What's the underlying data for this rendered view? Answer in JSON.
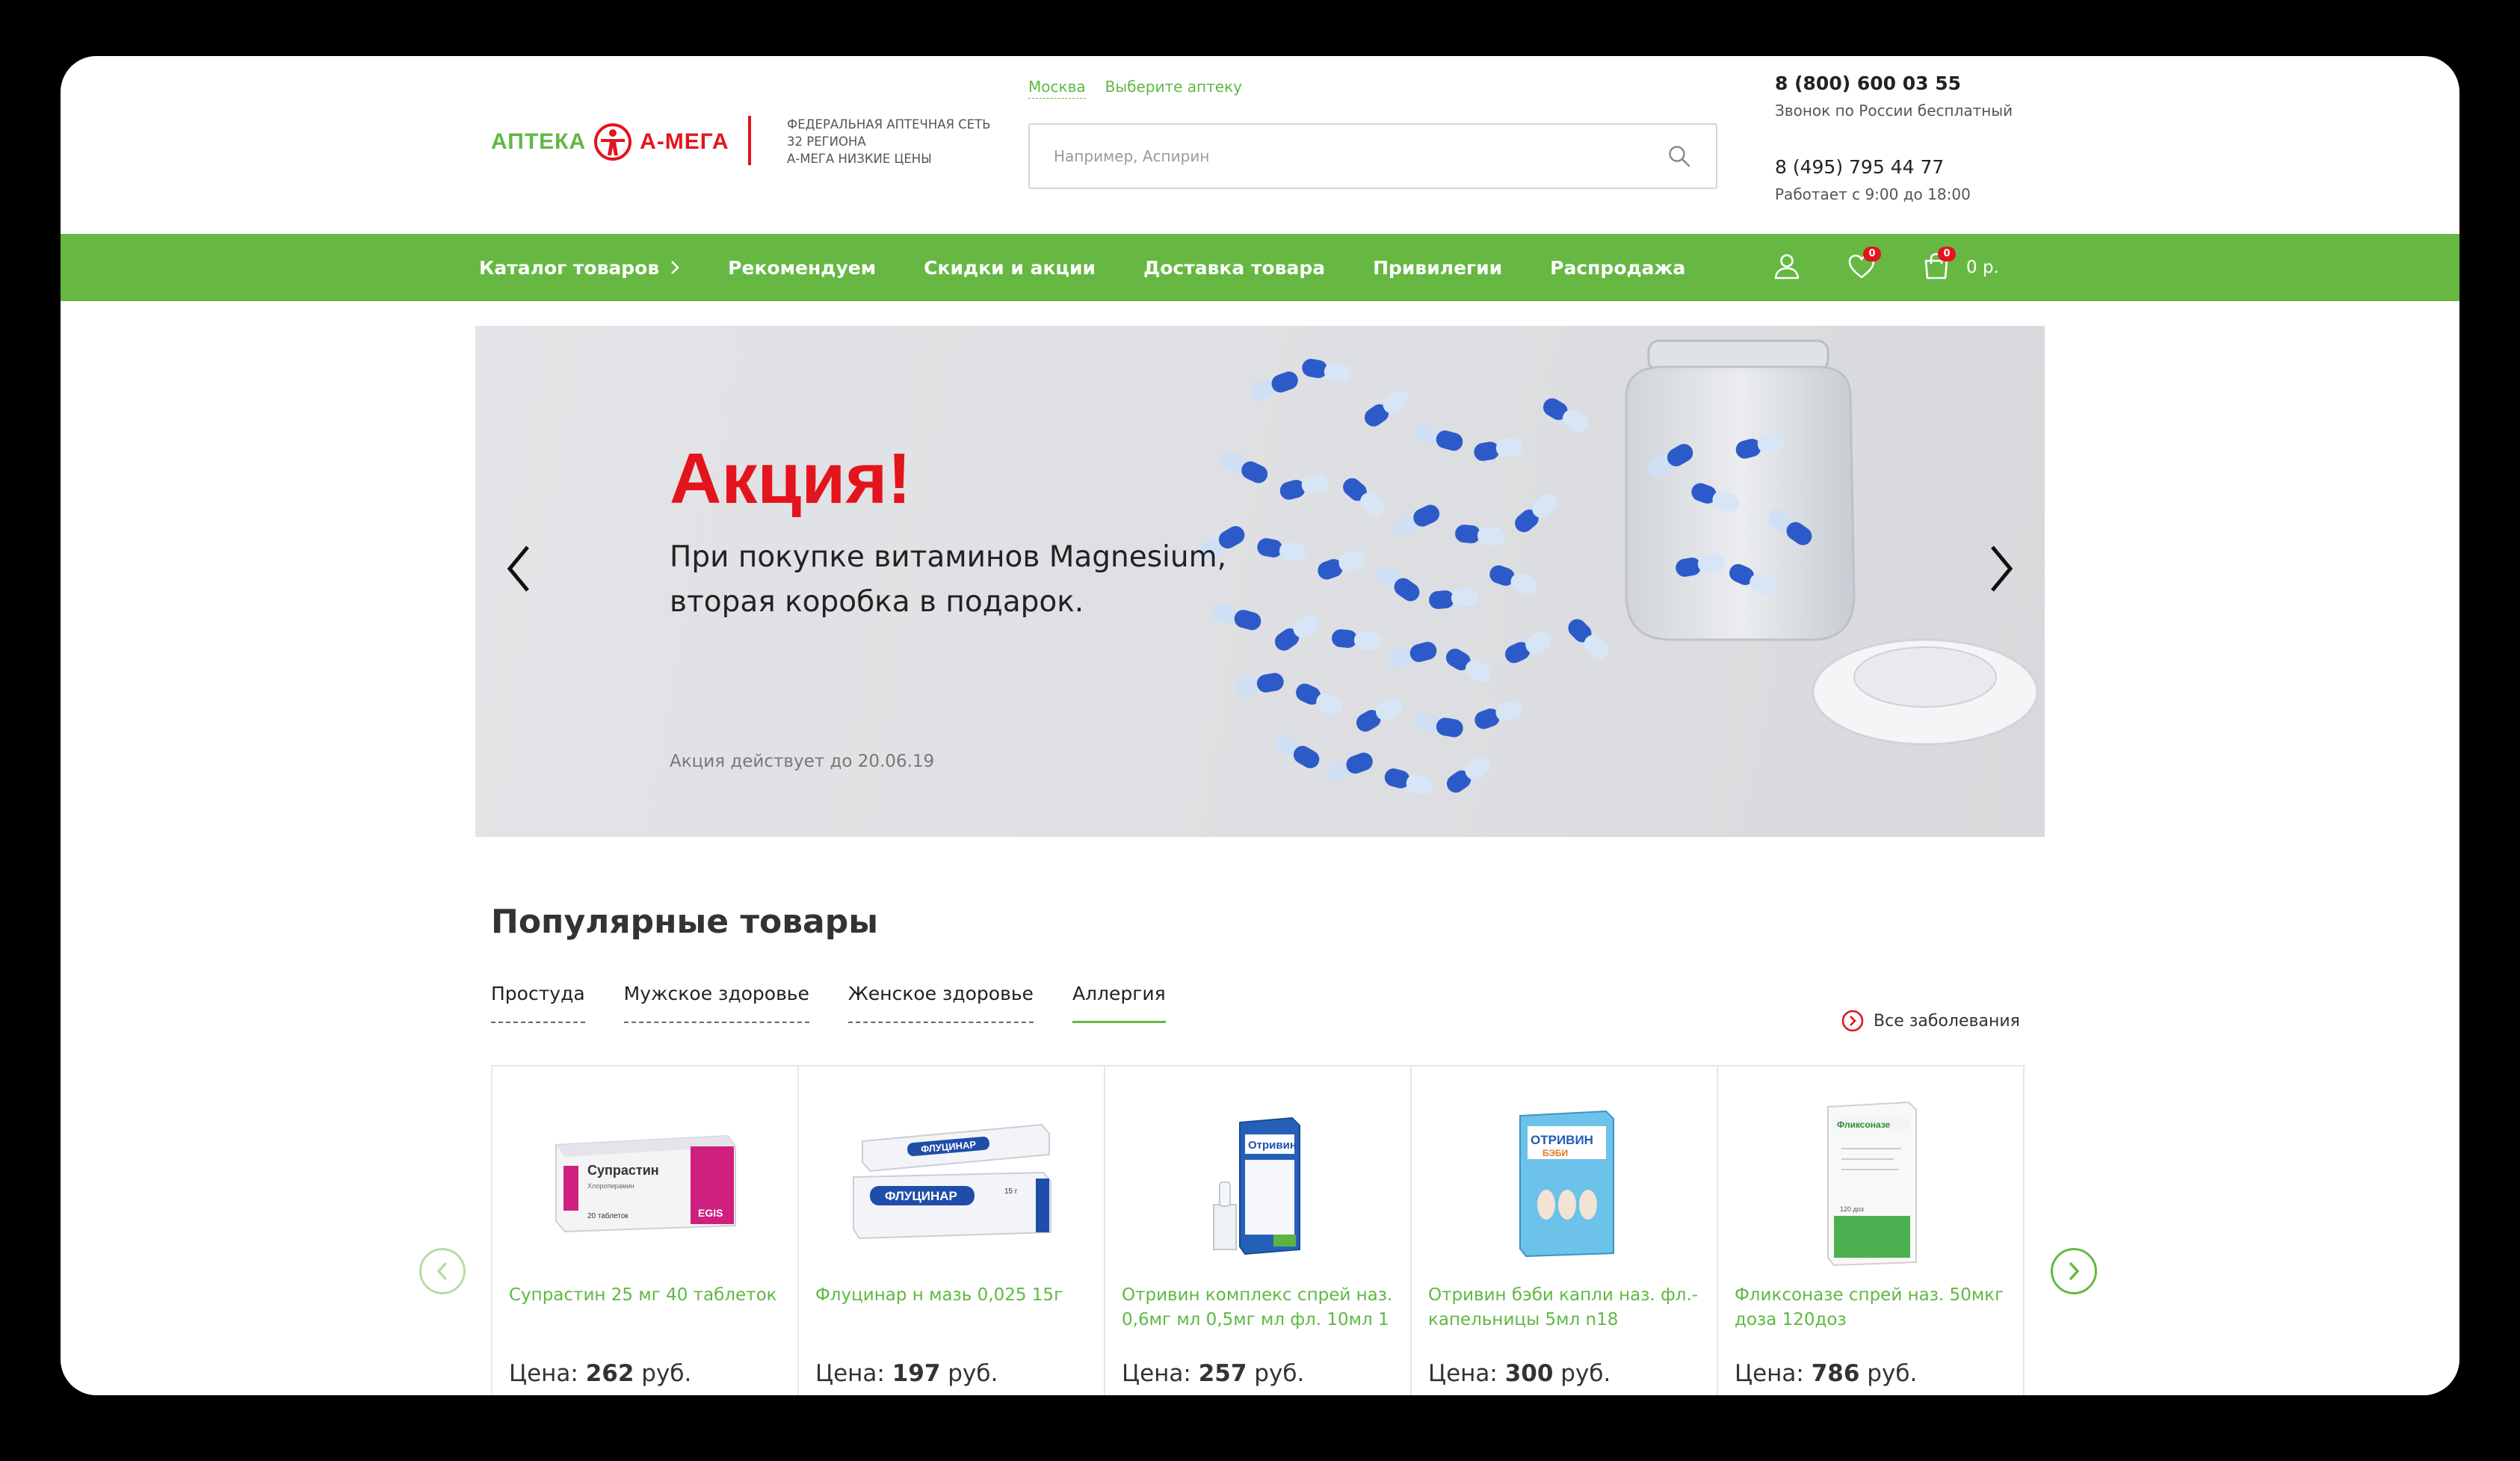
{
  "brand": {
    "name_left": "АПТЕКА",
    "name_right": "А-МЕГА",
    "tagline": [
      "ФЕДЕРАЛЬНАЯ АПТЕЧНАЯ СЕТЬ",
      "32 РЕГИОНА",
      "А-МЕГА НИЗКИЕ ЦЕНЫ"
    ],
    "colors": {
      "green": "#66b843",
      "red": "#e3141c"
    }
  },
  "location": {
    "city": "Москва",
    "choose_pharmacy": "Выберите аптеку"
  },
  "search": {
    "placeholder": "Например, Аспирин",
    "icon": "search-icon"
  },
  "contacts": {
    "phone1": "8 (800) 600 03 55",
    "phone1_note": "Звонок по России бесплатный",
    "phone2": "8 (495) 795 44 77",
    "phone2_note": "Работает с 9:00 до 18:00"
  },
  "nav": {
    "items": [
      "Каталог товаров",
      "Рекомендуем",
      "Скидки и акции",
      "Доставка товара",
      "Привилегии",
      "Распродажа"
    ],
    "favorites_count": "0",
    "cart_count": "0",
    "cart_sum": "0 р."
  },
  "banner": {
    "title": "Акция!",
    "text_line1": "При покупке витаминов Magnesium,",
    "text_line2": "вторая коробка в подарок.",
    "note": "Акция действует до 20.06.19"
  },
  "popular": {
    "title": "Популярные товары",
    "tabs": [
      "Простуда",
      "Мужское здоровье",
      "Женское здоровье",
      "Аллергия"
    ],
    "active_tab": "Аллергия",
    "all_link": "Все заболевания",
    "price_prefix": "Цена:",
    "price_suffix": "руб.",
    "products": [
      {
        "name": "Супрастин 25 мг 40 таблеток",
        "price": "262"
      },
      {
        "name": "Флуцинар н мазь 0,025 15г",
        "price": "197"
      },
      {
        "name": "Отривин комплекс спрей наз. 0,6мг мл 0,5мг мл фл. 10мл 1",
        "price": "257"
      },
      {
        "name": "Отривин бэби капли наз. фл.-капельницы 5мл n18",
        "price": "300"
      },
      {
        "name": "Фликсоназе спрей наз. 50мкг доза 120доз",
        "price": "786"
      }
    ],
    "package_labels": {
      "p1_brand": "Супрастин",
      "p1_sub": "Хлоропирамин",
      "p1_count": "20 таблеток",
      "p1_maker": "EGIS",
      "p2_brand": "ФЛУЦИНАР",
      "p2_weight": "15 г",
      "p3_brand": "Отривин",
      "p4_brand": "ОТРИВИН",
      "p4_sub": "БЭБИ",
      "p5_brand": "Фликсоназе",
      "p5_count": "120 доз"
    }
  }
}
